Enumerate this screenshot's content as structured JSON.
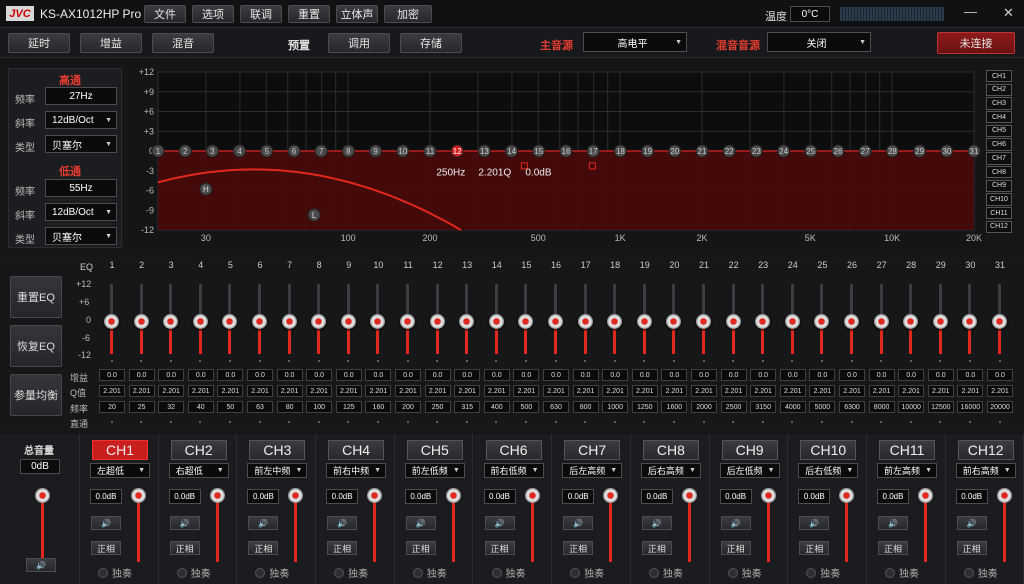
{
  "app": {
    "logo": "JVC",
    "model": "KS-AX1012HP Pro",
    "temp_label": "温度",
    "temp_value": "0°C",
    "menu": [
      "文件",
      "选项",
      "联调",
      "重置",
      "立体声",
      "加密"
    ],
    "minimize": "—",
    "close": "✕"
  },
  "toolbar": {
    "delay": "延时",
    "gain": "增益",
    "mix": "混音",
    "preset_label": "预置",
    "recall": "调用",
    "store": "存储",
    "main_source_label": "主音源",
    "main_source_value": "高电平",
    "mix_source_label": "混音音源",
    "mix_source_value": "关闭",
    "connect": "未连接"
  },
  "highpass": {
    "title": "高通",
    "freq_label": "频率",
    "freq": "27Hz",
    "slope_label": "斜率",
    "slope": "12dB/Oct",
    "type_label": "类型",
    "type": "贝塞尔"
  },
  "lowpass": {
    "title": "低通",
    "freq_label": "频率",
    "freq": "55Hz",
    "slope_label": "斜率",
    "slope": "12dB/Oct",
    "type_label": "类型",
    "type": "贝塞尔"
  },
  "graph": {
    "y_ticks": [
      "+12",
      "+9",
      "+6",
      "+3",
      "0",
      "-3",
      "-6",
      "-9",
      "-12"
    ],
    "x_ticks": [
      "30",
      "100",
      "200",
      "500",
      "1K",
      "2K",
      "5K",
      "10K",
      "20K"
    ],
    "readout_freq": "250Hz",
    "readout_q": "2.201Q",
    "readout_gain": "0.0dB",
    "h_marker": "H",
    "l_marker": "L",
    "selected_point": 12,
    "points": [
      "1",
      "2",
      "3",
      "4",
      "5",
      "6",
      "7",
      "8",
      "9",
      "10",
      "11",
      "12",
      "13",
      "14",
      "15",
      "16",
      "17",
      "18",
      "19",
      "20",
      "21",
      "22",
      "23",
      "24",
      "25",
      "26",
      "27",
      "28",
      "29",
      "30",
      "31"
    ]
  },
  "ch_list": [
    "CH1",
    "CH2",
    "CH3",
    "CH4",
    "CH5",
    "CH6",
    "CH7",
    "CH8",
    "CH9",
    "CH10",
    "CH11",
    "CH12"
  ],
  "eq": {
    "label": "EQ",
    "scale": [
      "+12",
      "+6",
      "0",
      "-6",
      "-12"
    ],
    "reset_btn": "重置EQ",
    "restore_btn": "恢复EQ",
    "param_btn": "参量均衡",
    "gain_label": "增益",
    "q_label": "Q值",
    "freq_label": "频率",
    "bypass_label": "直通",
    "bands": [
      "1",
      "2",
      "3",
      "4",
      "5",
      "6",
      "7",
      "8",
      "9",
      "10",
      "11",
      "12",
      "13",
      "14",
      "15",
      "16",
      "17",
      "18",
      "19",
      "20",
      "21",
      "22",
      "23",
      "24",
      "25",
      "26",
      "27",
      "28",
      "29",
      "30",
      "31"
    ],
    "gains": [
      "0.0",
      "0.0",
      "0.0",
      "0.0",
      "0.0",
      "0.0",
      "0.0",
      "0.0",
      "0.0",
      "0.0",
      "0.0",
      "0.0",
      "0.0",
      "0.0",
      "0.0",
      "0.0",
      "0.0",
      "0.0",
      "0.0",
      "0.0",
      "0.0",
      "0.0",
      "0.0",
      "0.0",
      "0.0",
      "0.0",
      "0.0",
      "0.0",
      "0.0",
      "0.0",
      "0.0"
    ],
    "qs": [
      "2.201",
      "2.201",
      "2.201",
      "2.201",
      "2.201",
      "2.201",
      "2.201",
      "2.201",
      "2.201",
      "2.201",
      "2.201",
      "2.201",
      "2.201",
      "2.201",
      "2.201",
      "2.201",
      "2.201",
      "2.201",
      "2.201",
      "2.201",
      "2.201",
      "2.201",
      "2.201",
      "2.201",
      "2.201",
      "2.201",
      "2.201",
      "2.201",
      "2.201",
      "2.201",
      "2.201"
    ],
    "freqs": [
      "20",
      "25",
      "32",
      "40",
      "50",
      "63",
      "80",
      "100",
      "125",
      "160",
      "200",
      "250",
      "315",
      "400",
      "500",
      "630",
      "800",
      "1000",
      "1250",
      "1600",
      "2000",
      "2500",
      "3150",
      "4000",
      "5000",
      "6300",
      "8000",
      "10000",
      "12500",
      "16000",
      "20000"
    ]
  },
  "master": {
    "title": "总音量",
    "value": "0dB",
    "speaker": "🔊"
  },
  "channels": [
    {
      "name": "CH1",
      "assign": "左超低",
      "db": "0.0dB",
      "phase": "正相",
      "solo": "独奏",
      "active": true
    },
    {
      "name": "CH2",
      "assign": "右超低",
      "db": "0.0dB",
      "phase": "正相",
      "solo": "独奏"
    },
    {
      "name": "CH3",
      "assign": "前左中频",
      "db": "0.0dB",
      "phase": "正相",
      "solo": "独奏"
    },
    {
      "name": "CH4",
      "assign": "前右中频",
      "db": "0.0dB",
      "phase": "正相",
      "solo": "独奏"
    },
    {
      "name": "CH5",
      "assign": "前左低频",
      "db": "0.0dB",
      "phase": "正相",
      "solo": "独奏"
    },
    {
      "name": "CH6",
      "assign": "前右低频",
      "db": "0.0dB",
      "phase": "正相",
      "solo": "独奏"
    },
    {
      "name": "CH7",
      "assign": "后左高频",
      "db": "0.0dB",
      "phase": "正相",
      "solo": "独奏"
    },
    {
      "name": "CH8",
      "assign": "后右高频",
      "db": "0.0dB",
      "phase": "正相",
      "solo": "独奏"
    },
    {
      "name": "CH9",
      "assign": "后左低频",
      "db": "0.0dB",
      "phase": "正相",
      "solo": "独奏"
    },
    {
      "name": "CH10",
      "assign": "后右低频",
      "db": "0.0dB",
      "phase": "正相",
      "solo": "独奏"
    },
    {
      "name": "CH11",
      "assign": "前左高频",
      "db": "0.0dB",
      "phase": "正相",
      "solo": "独奏"
    },
    {
      "name": "CH12",
      "assign": "前右高频",
      "db": "0.0dB",
      "phase": "正相",
      "solo": "独奏"
    }
  ],
  "colors": {
    "accent": "#e0281e",
    "graph_fill": "#4a0a0a"
  }
}
